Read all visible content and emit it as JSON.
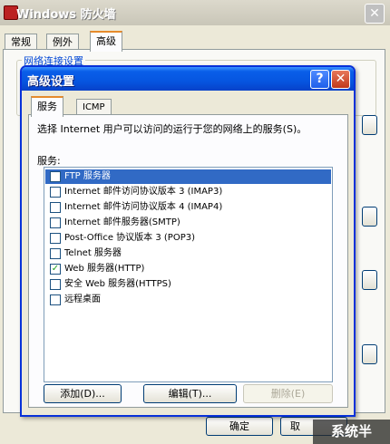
{
  "background_window": {
    "title": "Windows 防火墙",
    "close_glyph": "✕",
    "tabs": [
      {
        "label": "常规"
      },
      {
        "label": "例外"
      },
      {
        "label": "高级"
      }
    ],
    "group_label": "网络连接设置",
    "ok_label": "确定",
    "cancel_label": "取"
  },
  "dialog": {
    "title": "高级设置",
    "help_glyph": "?",
    "close_glyph": "✕",
    "tabs": [
      {
        "label": "服务"
      },
      {
        "label": "ICMP"
      }
    ],
    "description": "选择 Internet 用户可以访问的运行于您的网络上的服务(S)。",
    "services_label": "服务:",
    "services": [
      {
        "label": "FTP 服务器",
        "checked": false,
        "selected": true
      },
      {
        "label": "Internet 邮件访问协议版本 3 (IMAP3)",
        "checked": false,
        "selected": false
      },
      {
        "label": "Internet 邮件访问协议版本 4 (IMAP4)",
        "checked": false,
        "selected": false
      },
      {
        "label": "Internet 邮件服务器(SMTP)",
        "checked": false,
        "selected": false
      },
      {
        "label": "Post-Office 协议版本 3 (POP3)",
        "checked": false,
        "selected": false
      },
      {
        "label": "Telnet 服务器",
        "checked": false,
        "selected": false
      },
      {
        "label": "Web 服务器(HTTP)",
        "checked": true,
        "selected": false
      },
      {
        "label": "安全 Web 服务器(HTTPS)",
        "checked": false,
        "selected": false
      },
      {
        "label": "远程桌面",
        "checked": false,
        "selected": false
      }
    ],
    "buttons": {
      "add": "添加(D)...",
      "edit": "编辑(T)...",
      "delete": "删除(E)"
    }
  },
  "watermark": "系统半"
}
